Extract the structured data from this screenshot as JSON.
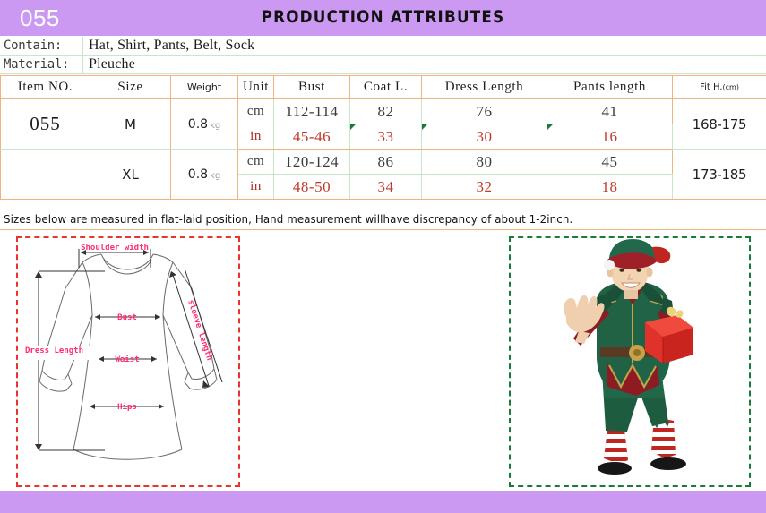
{
  "header": {
    "code": "055",
    "title": "PRODUCTION ATTRIBUTES",
    "bg_color": "#cb99f2",
    "code_color": "#ffffff"
  },
  "info": {
    "contain_label": "Contain:",
    "contain_value": "Hat, Shirt, Pants, Belt, Sock",
    "material_label": "Material:",
    "material_value": "Pleuche"
  },
  "size_table": {
    "columns": [
      "Item NO.",
      "Size",
      "Weight",
      "Unit",
      "Bust",
      "Coat L.",
      "Dress Length",
      "Pants length",
      "Fit H."
    ],
    "fit_unit": "(cm)",
    "rows": [
      {
        "item_no": "055",
        "size": "M",
        "weight": "0.8",
        "weight_unit": "kg",
        "fit_height": "168-175",
        "cm": {
          "unit": "cm",
          "bust": "112-114",
          "coat_l": "82",
          "dress_length": "76",
          "pants_length": "41"
        },
        "in": {
          "unit": "in",
          "bust": "45-46",
          "coat_l": "33",
          "dress_length": "30",
          "pants_length": "16"
        }
      },
      {
        "item_no": "",
        "size": "XL",
        "weight": "0.8",
        "weight_unit": "kg",
        "fit_height": "173-185",
        "cm": {
          "unit": "cm",
          "bust": "120-124",
          "coat_l": "86",
          "dress_length": "80",
          "pants_length": "45"
        },
        "in": {
          "unit": "in",
          "bust": "48-50",
          "coat_l": "34",
          "dress_length": "32",
          "pants_length": "18"
        }
      }
    ],
    "border_color": "#f0b37e",
    "inner_border_color": "#c8e6c9",
    "cm_text_color": "#3b3b3b",
    "in_text_color": "#c0392b"
  },
  "note": "Sizes below are measured in flat-laid position, Hand measurement willhave discrepancy of about 1-2inch.",
  "diagram": {
    "border_color": "#e8342a",
    "label_color": "#ff2d6f",
    "labels": {
      "shoulder_width": "Shoulder width",
      "bust": "Bust",
      "waist": "Waist",
      "hips": "Hips",
      "dress_length": "Dress Length",
      "sleeve_length": "sleeve length"
    }
  },
  "photo": {
    "border_color": "#1a7a3c",
    "alt": "Man wearing green and red Christmas elf costume with hat, waving and holding a red gift box, wearing red-and-white striped socks"
  },
  "footer": {
    "bg_color": "#cb99f2"
  }
}
